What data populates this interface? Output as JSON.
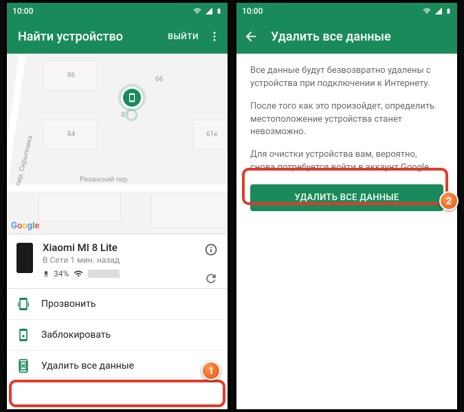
{
  "statusbar": {
    "time": "10:00"
  },
  "left": {
    "appbar": {
      "title": "Найти устройство",
      "exit": "ВЫЙТИ"
    },
    "map": {
      "attribution": "Google",
      "streets": [
        "Рязанский пер.",
        "пер. Скрыпника"
      ],
      "house_numbers": [
        "86",
        "84",
        "82",
        "66",
        "61к"
      ]
    },
    "device": {
      "name": "Xiaomi MI 8 Lite",
      "status": "В Сети 1 мин. назад",
      "battery": "34%"
    },
    "actions": [
      {
        "icon": "ring-icon",
        "label": "Прозвонить"
      },
      {
        "icon": "lock-icon",
        "label": "Заблокировать"
      },
      {
        "icon": "erase-icon",
        "label": "Удалить все данные"
      }
    ]
  },
  "right": {
    "appbar": {
      "title": "Удалить все данные"
    },
    "para1": "Все данные будут безвозвратно удалены с устройства при подключении к Интернету.",
    "para2": "После того как это произойдет, определить местоположение устройства станет невозможно.",
    "para3": "Для очистки устройства вам, вероятно, снова потребуется войти в аккаунт Google.",
    "button": "УДАЛИТЬ ВСЕ ДАННЫЕ"
  },
  "annotations": {
    "step1": "1",
    "step2": "2"
  }
}
